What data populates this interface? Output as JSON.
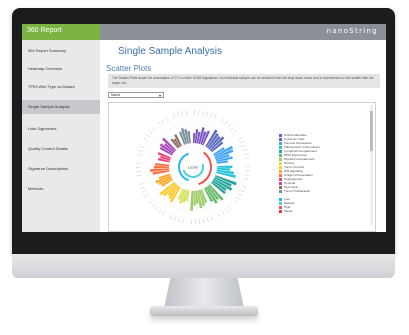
{
  "app": {
    "title": "360 Report",
    "brand": "nanoString"
  },
  "sidebar": {
    "items": [
      {
        "label": "360 Report Summary",
        "active": false
      },
      {
        "label": "Heatmap Overview",
        "active": false
      },
      {
        "label": "TP53 Wild Type vs Mutant",
        "active": false
      },
      {
        "label": "Single Sample Analysis",
        "active": true
      },
      {
        "label": "Lists Signatures",
        "active": false
      },
      {
        "label": "Quality Control Details",
        "active": false
      },
      {
        "label": "Signature Descriptions",
        "active": false
      },
      {
        "label": "Methods",
        "active": false
      }
    ]
  },
  "main": {
    "title": "Single Sample Analysis",
    "section": "Scatter Plots",
    "description": "The Scatter Plots depict the association of TCI to other IO360 signatures. An individual sample can be selected from the drop down menu and is represented on the scatter with the larger red.",
    "select_value": "Name"
  },
  "colors": {
    "accent_green": "#7cb342",
    "title_blue": "#3a6ea5",
    "topbar_gray": "#8b9097"
  },
  "chart_data": {
    "type": "radial-bar",
    "center_label": "Lucile",
    "legend_groups": [
      {
        "entries": [
          {
            "name": "Anti-Proliferative",
            "color": "#7e57c2"
          },
          {
            "name": "Cytotoxic Cells",
            "color": "#5c6bc0"
          },
          {
            "name": "Immune Checkpoint",
            "color": "#42a5f5"
          },
          {
            "name": "Inflammatory Chemokines",
            "color": "#26c6da"
          },
          {
            "name": "Lymphoid Compartment",
            "color": "#26a69a"
          },
          {
            "name": "MHC Expression",
            "color": "#66bb6a"
          },
          {
            "name": "Myeloid Compartment",
            "color": "#9ccc65"
          },
          {
            "name": "Stroma",
            "color": "#d4e157"
          },
          {
            "name": "Tumor Intrinsic",
            "color": "#ffca28"
          },
          {
            "name": "IFN Signaling",
            "color": "#ffa726"
          },
          {
            "name": "Antigen Presentation",
            "color": "#ff7043"
          },
          {
            "name": "Angiogenesis",
            "color": "#ec407a"
          },
          {
            "name": "Hypoxia",
            "color": "#ab47bc"
          },
          {
            "name": "Glycolysis",
            "color": "#8d6e63"
          },
          {
            "name": "Tumor Proliferation",
            "color": "#78909c"
          }
        ]
      },
      {
        "entries": [
          {
            "name": "Low",
            "color": "#29b6f6"
          },
          {
            "name": "Medium",
            "color": "#4dd0e1"
          },
          {
            "name": "High",
            "color": "#ef5350"
          },
          {
            "name": "Mixed",
            "color": "#e53935"
          }
        ]
      }
    ],
    "sectors": [
      {
        "group": "Anti-Proliferative",
        "values": [
          0.35,
          0.5,
          0.42,
          0.6,
          0.48,
          0.55
        ]
      },
      {
        "group": "Cytotoxic Cells",
        "values": [
          0.7,
          0.62,
          0.58,
          0.66,
          0.52
        ]
      },
      {
        "group": "Immune Checkpoint",
        "values": [
          0.45,
          0.72,
          0.68,
          0.5,
          0.6,
          0.4
        ]
      },
      {
        "group": "Inflammatory Chemokines",
        "values": [
          0.55,
          0.48,
          0.62,
          0.7
        ]
      },
      {
        "group": "Lymphoid Compartment",
        "values": [
          0.8,
          0.66,
          0.74,
          0.58,
          0.62
        ]
      },
      {
        "group": "MHC Expression",
        "values": [
          0.72,
          0.6,
          0.68,
          0.55
        ]
      },
      {
        "group": "Myeloid Compartment",
        "values": [
          0.5,
          0.58,
          0.64,
          0.46,
          0.52,
          0.7
        ]
      },
      {
        "group": "Stroma",
        "values": [
          0.38,
          0.45,
          0.52,
          0.4
        ]
      },
      {
        "group": "Tumor Intrinsic",
        "values": [
          0.62,
          0.55,
          0.48,
          0.6,
          0.66
        ]
      },
      {
        "group": "IFN Signaling",
        "values": [
          0.44,
          0.5,
          0.58,
          0.42
        ]
      },
      {
        "group": "Antigen Presentation",
        "values": [
          0.6,
          0.68,
          0.54,
          0.5
        ]
      },
      {
        "group": "Angiogenesis",
        "values": [
          0.42,
          0.36,
          0.48
        ]
      },
      {
        "group": "Hypoxia",
        "values": [
          0.5,
          0.56,
          0.44,
          0.62
        ]
      },
      {
        "group": "Glycolysis",
        "values": [
          0.4,
          0.34,
          0.46
        ]
      },
      {
        "group": "Tumor Proliferation",
        "values": [
          0.48,
          0.58,
          0.52,
          0.44
        ]
      }
    ]
  }
}
